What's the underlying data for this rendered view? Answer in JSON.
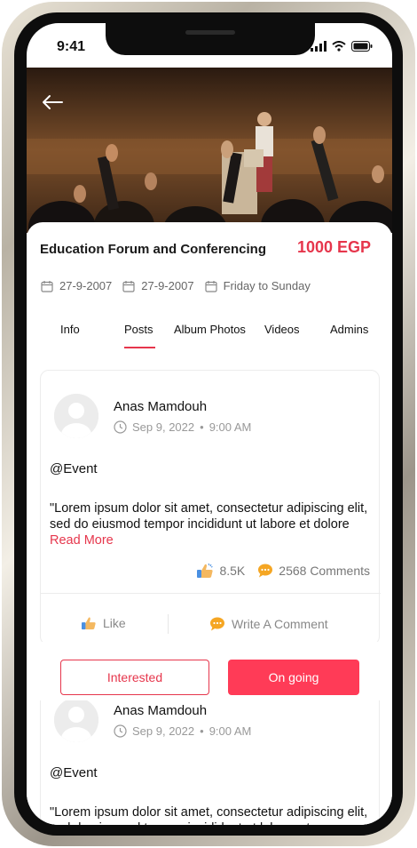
{
  "status_bar": {
    "time": "9:41"
  },
  "event": {
    "title": "Education Forum and Conferencing",
    "price": "1000 EGP",
    "start_date": "27-9-2007",
    "end_date": "27-9-2007",
    "days": "Friday to Sunday"
  },
  "tabs": [
    {
      "label": "Info"
    },
    {
      "label": "Posts",
      "active": true
    },
    {
      "label": "Album Photos"
    },
    {
      "label": "Videos"
    },
    {
      "label": "Admins"
    }
  ],
  "posts": [
    {
      "author": "Anas Mamdouh",
      "date": "Sep 9, 2022",
      "time": "9:00 AM",
      "mention": "@Event",
      "body": "\"Lorem ipsum dolor sit amet, consectetur adipiscing elit, sed do eiusmod tempor incididunt ut labore et dolore",
      "read_more": "Read More",
      "likes": "8.5K",
      "comments": "2568 Comments",
      "like_label": "Like",
      "comment_label": "Write A Comment"
    },
    {
      "author": "Anas Mamdouh",
      "date": "Sep 9, 2022",
      "time": "9:00 AM",
      "mention": "@Event",
      "body": "\"Lorem ipsum dolor sit amet, consectetur adipiscing elit, sed do eiusmod tempor incididunt ut labore et"
    }
  ],
  "actions": {
    "interested": "Interested",
    "ongoing": "On going"
  },
  "colors": {
    "accent": "#e6364c",
    "button_fill": "#ff3b57"
  }
}
